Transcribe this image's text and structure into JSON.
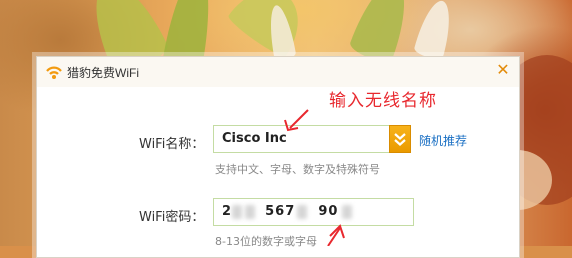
{
  "window": {
    "title": "猎豹免费WiFi",
    "close_icon": "close-icon",
    "accent_color": "#e38b0a"
  },
  "form": {
    "name_label": "WiFi名称：",
    "name_value": "Cisco Inc",
    "name_hint": "支持中文、字母、数字及特殊符号",
    "random_label": "随机推荐",
    "password_label": "WiFi密码：",
    "password_value_visible_parts": [
      "2",
      "567",
      "90"
    ],
    "password_hint": "8-13位的数字或字母"
  },
  "annotation": {
    "text": "输入无线名称",
    "color": "#e8282e"
  }
}
